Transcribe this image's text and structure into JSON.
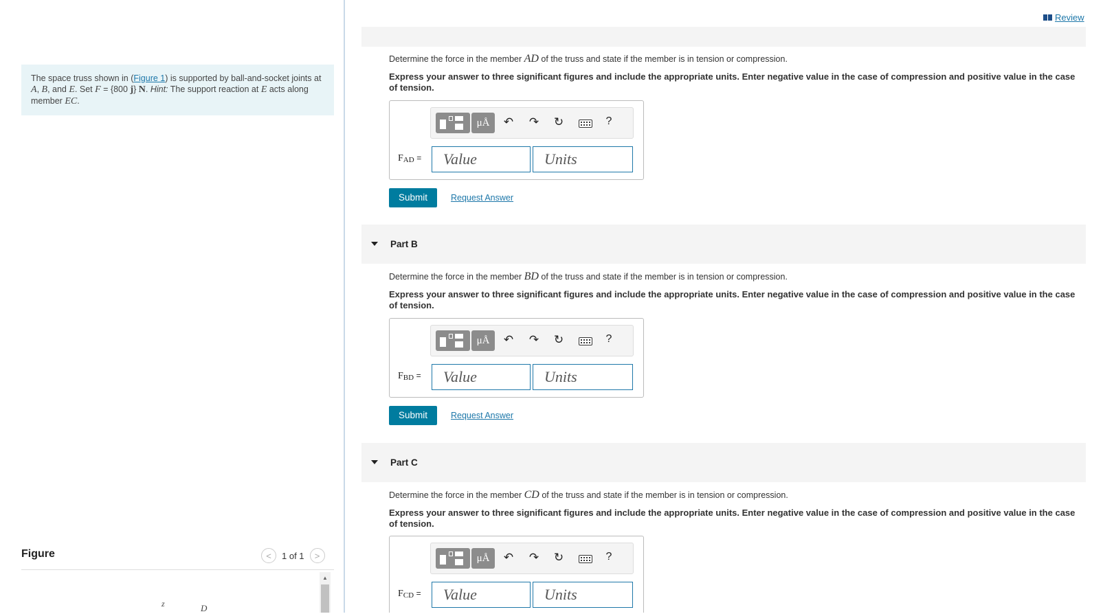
{
  "problem": {
    "text_1": "The space truss shown in (",
    "figure_link": "Figure 1",
    "text_2": ") is supported by ball-and-socket joints at ",
    "a": "A",
    "comma1": ", ",
    "b": "B",
    "and": ", and ",
    "e": "E",
    "text_3": ". Set ",
    "f": "F",
    "text_4": " = {800 ",
    "j": "j",
    "text_5": "} ",
    "n": "N",
    "text_6": ". ",
    "hint": "Hint:",
    "text_7": " The support reaction at ",
    "e2": "E",
    "text_8": " acts along member ",
    "ec": "EC",
    "text_9": "."
  },
  "figure": {
    "title": "Figure",
    "counter": "1 of 1",
    "axis_z": "z",
    "label_d": "D"
  },
  "review": {
    "label": "Review"
  },
  "parts": [
    {
      "header": "",
      "q_prefix": "Determine the force in the member ",
      "member": "AD",
      "q_suffix": " of the truss and state if the member is in tension or compression.",
      "instruction": "Express your answer to three significant figures and include the appropriate units. Enter negative value in the case of compression and positive value in the case of tension.",
      "f_label": "F",
      "f_sub": "AD",
      "equals": "=",
      "value_placeholder": "Value",
      "units_placeholder": "Units",
      "submit": "Submit",
      "request": "Request Answer"
    },
    {
      "header": "Part B",
      "q_prefix": "Determine the force in the member ",
      "member": "BD",
      "q_suffix": " of the truss and state if the member is in tension or compression.",
      "instruction": "Express your answer to three significant figures and include the appropriate units. Enter negative value in the case of compression and positive value in the case of tension.",
      "f_label": "F",
      "f_sub": "BD",
      "equals": "=",
      "value_placeholder": "Value",
      "units_placeholder": "Units",
      "submit": "Submit",
      "request": "Request Answer"
    },
    {
      "header": "Part C",
      "q_prefix": "Determine the force in the member ",
      "member": "CD",
      "q_suffix": " of the truss and state if the member is in tension or compression.",
      "instruction": "Express your answer to three significant figures and include the appropriate units. Enter negative value in the case of compression and positive value in the case of tension.",
      "f_label": "F",
      "f_sub": "CD",
      "equals": "=",
      "value_placeholder": "Value",
      "units_placeholder": "Units"
    }
  ],
  "toolbar": {
    "mu_label": "μÅ",
    "undo": "↶",
    "redo": "↷",
    "reset": "↻",
    "help": "?"
  },
  "icons": [
    "templates-icon",
    "mu-angstrom-icon",
    "undo-icon",
    "redo-icon",
    "reset-icon",
    "keyboard-icon",
    "help-icon",
    "book-icon",
    "chevron-left-icon",
    "chevron-right-icon",
    "disclosure-triangle-icon"
  ],
  "colors": {
    "accent": "#007c9f",
    "link": "#1d77a9",
    "problem_bg": "#e8f4f7"
  }
}
